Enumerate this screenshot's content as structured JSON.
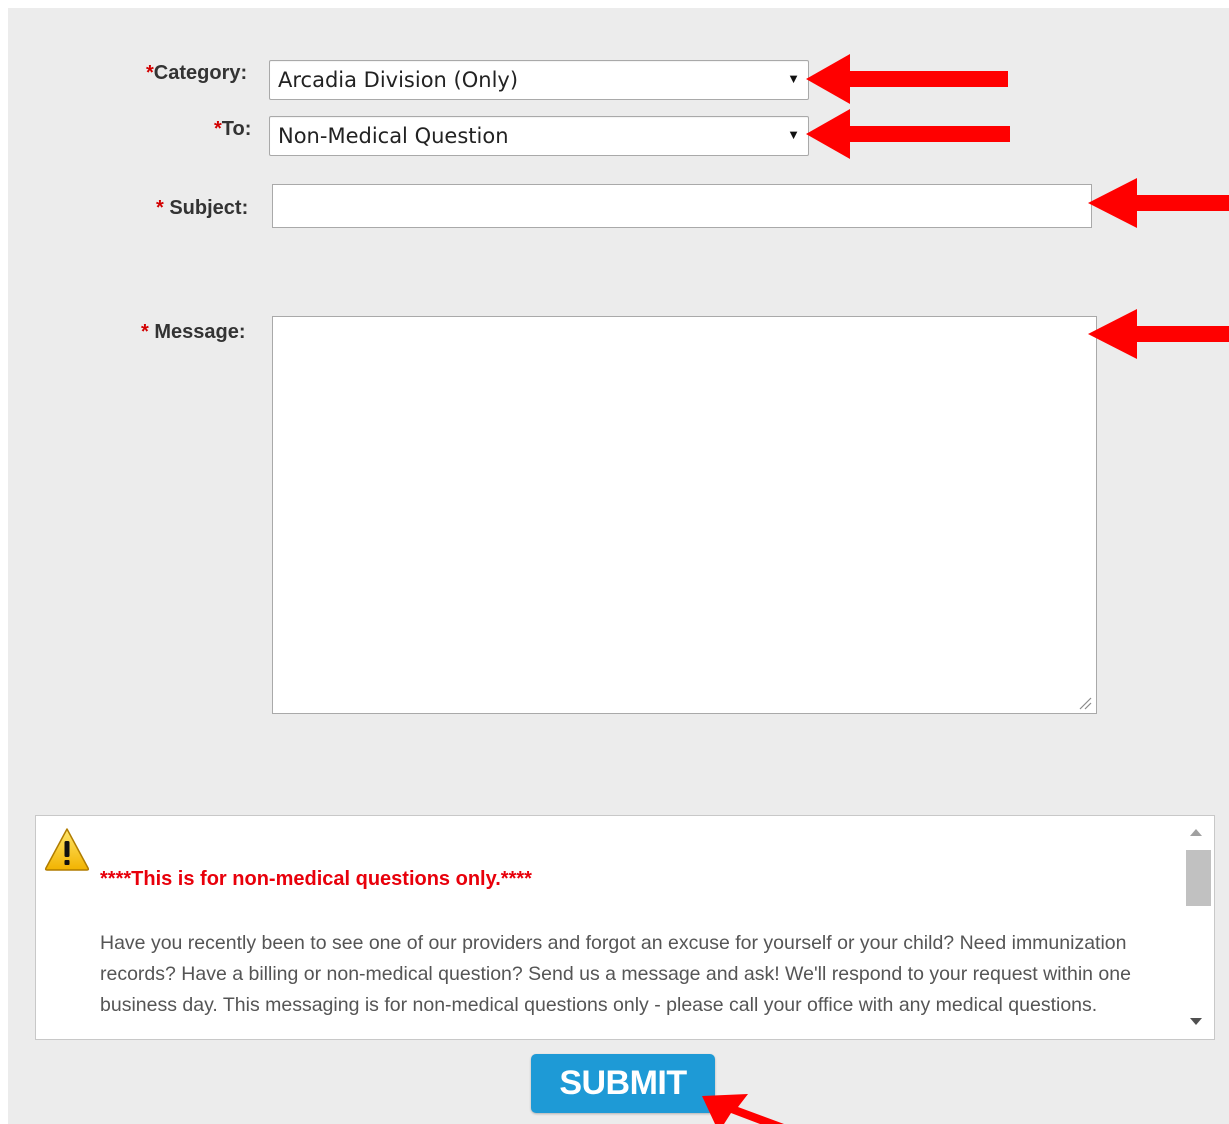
{
  "form": {
    "category": {
      "required_mark": "*",
      "label": "Category:",
      "selected_value": "Arcadia Division (Only)"
    },
    "to": {
      "required_mark": "*",
      "label": "To:",
      "selected_value": "Non-Medical Question"
    },
    "subject": {
      "required_mark": "* ",
      "label": "Subject:",
      "value": ""
    },
    "message": {
      "required_mark": "* ",
      "label": "Message:",
      "value": ""
    }
  },
  "notice": {
    "icon": "warning-icon",
    "title": "****This is for non-medical questions only.****",
    "body": "Have you recently been to see one of our providers and forgot an excuse for yourself or your child? Need immunization records? Have a billing or non-medical question? Send us a message and ask! We'll respond to your request within one business day. This messaging is for non-medical questions only - please call your office with any medical questions."
  },
  "submit": {
    "label": "SUBMIT"
  },
  "colors": {
    "annotation_arrow": "#ff0000",
    "submit_button": "#1e9ad6",
    "required_mark": "#d20000",
    "notice_title": "#e8000b",
    "panel_background": "#ececec"
  }
}
